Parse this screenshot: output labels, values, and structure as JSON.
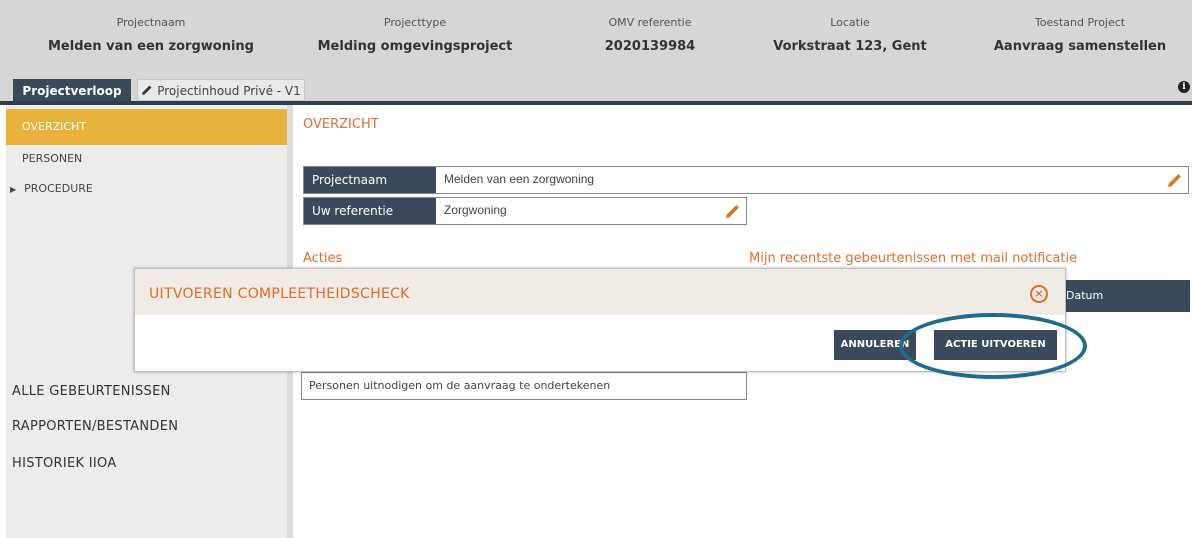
{
  "header": {
    "columns": [
      {
        "label": "Projectnaam",
        "value": "Melden van een zorgwoning"
      },
      {
        "label": "Projecttype",
        "value": "Melding omgevingsproject"
      },
      {
        "label": "OMV referentie",
        "value": "2020139984"
      },
      {
        "label": "Locatie",
        "value": "Vorkstraat 123, Gent"
      },
      {
        "label": "Toestand Project",
        "value": "Aanvraag samenstellen"
      }
    ]
  },
  "tabs": {
    "active": "Projectverloop",
    "second": "Projectinhoud Privé - V1",
    "info_icon": "i"
  },
  "sidebar": {
    "items": [
      {
        "label": "OVERZICHT"
      },
      {
        "label": "PERSONEN"
      },
      {
        "label": "PROCEDURE"
      }
    ],
    "bottom_items": [
      {
        "label": "ALLE GEBEURTENISSEN"
      },
      {
        "label": "RAPPORTEN/BESTANDEN"
      },
      {
        "label": "HISTORIEK IIOA"
      }
    ]
  },
  "main": {
    "title": "OVERZICHT",
    "fields": [
      {
        "label": "Projectnaam",
        "value": "Melden van een zorgwoning"
      },
      {
        "label": "Uw referentie",
        "value": "Zorgwoning"
      }
    ],
    "acties_title": "Acties",
    "recent_title": "Mijn recentste gebeurtenissen met mail notificatie",
    "datum_header": "Datum",
    "action_item": "Personen uitnodigen om de aanvraag te ondertekenen"
  },
  "modal": {
    "title": "UITVOEREN COMPLEETHEIDSCHECK",
    "close_symbol": "×",
    "cancel_label": "ANNULEREN",
    "confirm_label": "ACTIE UITVOEREN"
  },
  "colors": {
    "accent_orange": "#e06c2a",
    "nav_dark": "#3a4a5a",
    "active_yellow": "#e8b23d",
    "highlight_blue": "#1f6a8f"
  }
}
